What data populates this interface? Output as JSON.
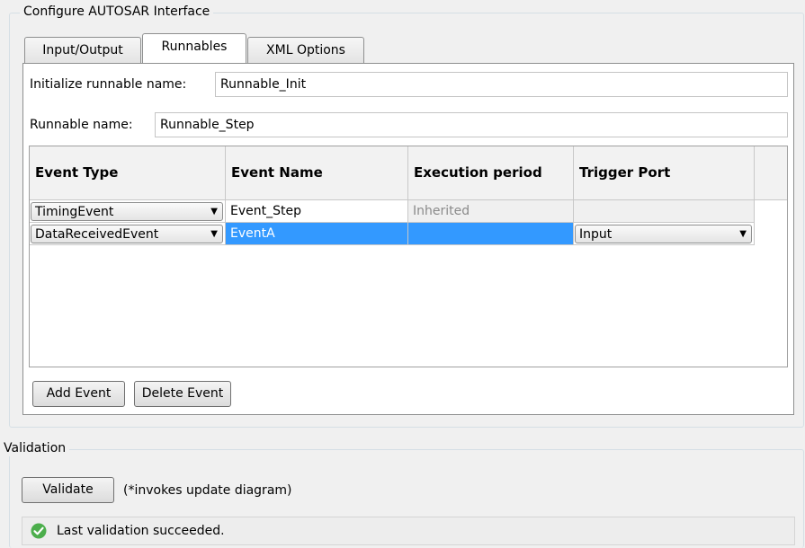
{
  "config_group": {
    "title": "Configure AUTOSAR Interface"
  },
  "tabs": [
    {
      "label": "Input/Output"
    },
    {
      "label": "Runnables"
    },
    {
      "label": "XML Options"
    }
  ],
  "init_runnable": {
    "label": "Initialize runnable name:",
    "value": "Runnable_Init"
  },
  "runnable": {
    "label": "Runnable name:",
    "value": "Runnable_Step"
  },
  "table": {
    "headers": [
      "Event Type",
      "Event Name",
      "Execution period",
      "Trigger Port"
    ],
    "rows": [
      {
        "event_type": "TimingEvent",
        "event_name": "Event_Step",
        "execution_period": "Inherited",
        "trigger_port": ""
      },
      {
        "event_type": "DataReceivedEvent",
        "event_name": "EventA",
        "execution_period": "",
        "trigger_port": "Input"
      }
    ]
  },
  "buttons": {
    "add_event": "Add Event",
    "delete_event": "Delete Event"
  },
  "validation": {
    "title": "Validation",
    "validate_label": "Validate",
    "note": "(*invokes update diagram)",
    "status": "Last validation succeeded."
  },
  "icons": {
    "status_icon": "check-circle-icon",
    "dropdown_icon": "chevron-down-icon"
  },
  "colors": {
    "selection": "#3399ff",
    "success": "#4cae4c"
  }
}
